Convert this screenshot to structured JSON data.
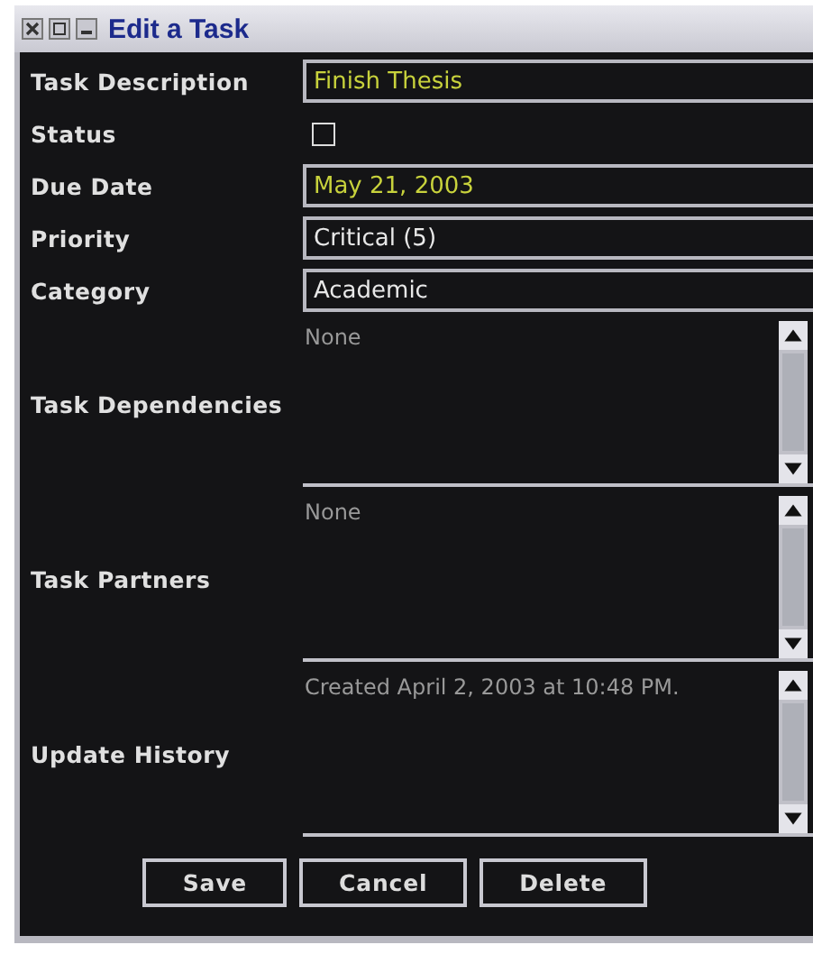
{
  "window": {
    "title": "Edit a Task"
  },
  "fields": [
    {
      "label": "Task Description",
      "kind": "text",
      "value": "Finish Thesis"
    },
    {
      "label": "Status",
      "kind": "checkbox",
      "checked": false
    },
    {
      "label": "Due Date",
      "kind": "text",
      "value": "May 21, 2003"
    },
    {
      "label": "Priority",
      "kind": "combo",
      "value": "Critical (5)"
    },
    {
      "label": "Category",
      "kind": "combo",
      "value": "Academic"
    },
    {
      "label": "Task Dependencies",
      "kind": "list",
      "value": "None"
    },
    {
      "label": "Task Partners",
      "kind": "list",
      "value": "None"
    },
    {
      "label": "Update History",
      "kind": "list",
      "value": "Created April 2, 2003 at 10:48 PM."
    }
  ],
  "buttons": [
    "Save",
    "Cancel",
    "Delete"
  ]
}
